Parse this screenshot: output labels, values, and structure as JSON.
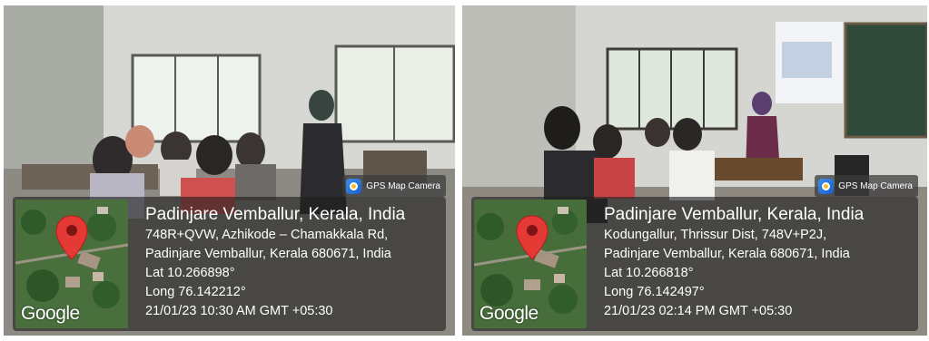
{
  "badge_label": "GPS Map Camera",
  "watermark": "Google",
  "left": {
    "title": "Padinjare Vemballur, Kerala, India",
    "address_line1": "748R+QVW, Azhikode – Chamakkala Rd,",
    "address_line2": "Padinjare Vemballur, Kerala 680671, India",
    "lat": "Lat 10.266898°",
    "long": "Long 76.142212°",
    "datetime": "21/01/23 10:30 AM GMT +05:30"
  },
  "right": {
    "title": "Padinjare Vemballur, Kerala, India",
    "address_line1": "Kodungallur, Thrissur Dist, 748V+P2J,",
    "address_line2": "Padinjare Vemballur, Kerala 680671, India",
    "lat": "Lat 10.266818°",
    "long": "Long 76.142497°",
    "datetime": "21/01/23 02:14 PM GMT +05:30"
  }
}
